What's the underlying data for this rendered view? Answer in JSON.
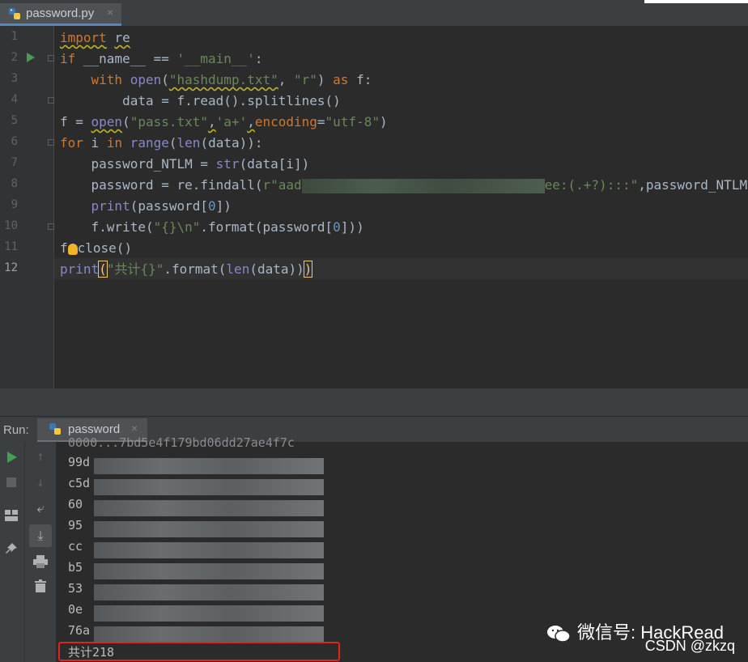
{
  "tab": {
    "filename": "password.py",
    "close": "×"
  },
  "editor": {
    "line_numbers": [
      "1",
      "2",
      "3",
      "4",
      "5",
      "6",
      "7",
      "8",
      "9",
      "10",
      "11",
      "12"
    ]
  },
  "code": {
    "l1_kw": "import",
    "l1_mod": "re",
    "l2_kw": "if",
    "l2_a": "__name__ == ",
    "l2_str": "'__main__'",
    "l2_b": ":",
    "l3_kw": "with",
    "l3_fn": "open",
    "l3_p1": "(",
    "l3_s1": "\"hashdump.txt\"",
    "l3_p2": ", ",
    "l3_s2": "\"r\"",
    "l3_p3": ") ",
    "l3_kw2": "as",
    "l3_p4": " f:",
    "l4": "data = f.read().splitlines()",
    "l5_a": "f = ",
    "l5_fn": "open",
    "l5_p1": "(",
    "l5_s1": "\"pass.txt\"",
    "l5_p2": ",",
    "l5_s2": "'a+'",
    "l5_p3": ",",
    "l5_kw": "encoding",
    "l5_p4": "=",
    "l5_s3": "\"utf-8\"",
    "l5_p5": ")",
    "l6_kw": "for",
    "l6_a": " i ",
    "l6_kw2": "in",
    "l6_fn": "range",
    "l6_p1": "(",
    "l6_fn2": "len",
    "l6_p2": "(data)):",
    "l7_a": "password_NTLM = ",
    "l7_fn": "str",
    "l7_p": "(data[i])",
    "l8_a": "password = re.findall(",
    "l8_s1": "r\"aad",
    "l8_s2": "ee:(.+?):::\"",
    "l8_p": ",password_NTLM)",
    "l9_fn": "print",
    "l9_a": "(password[",
    "l9_n": "0",
    "l9_b": "])",
    "l10_a": "f.write(",
    "l10_s": "\"{}\\n\"",
    "l10_b": ".format(password[",
    "l10_n": "0",
    "l10_c": "]))",
    "l11_a": "f",
    "l11_b": "close()",
    "l12_fn": "print",
    "l12_p1": "(",
    "l12_s": "\"共计{}\"",
    "l12_a": ".format(",
    "l12_fn2": "len",
    "l12_b": "(data))",
    "l12_p2": ")"
  },
  "run": {
    "label": "Run:",
    "tab_name": "password",
    "close": "×"
  },
  "console": {
    "partial_top": "0000...7bd5e4f179bd06dd27ae4f7c",
    "lines": [
      "99d",
      "c5d",
      "60",
      "95",
      "cc",
      "b5",
      "53",
      "0e",
      "76a"
    ],
    "total": "共计218"
  },
  "watermark": {
    "wechat": "微信号: HackRead",
    "csdn": "CSDN @zkzq"
  }
}
